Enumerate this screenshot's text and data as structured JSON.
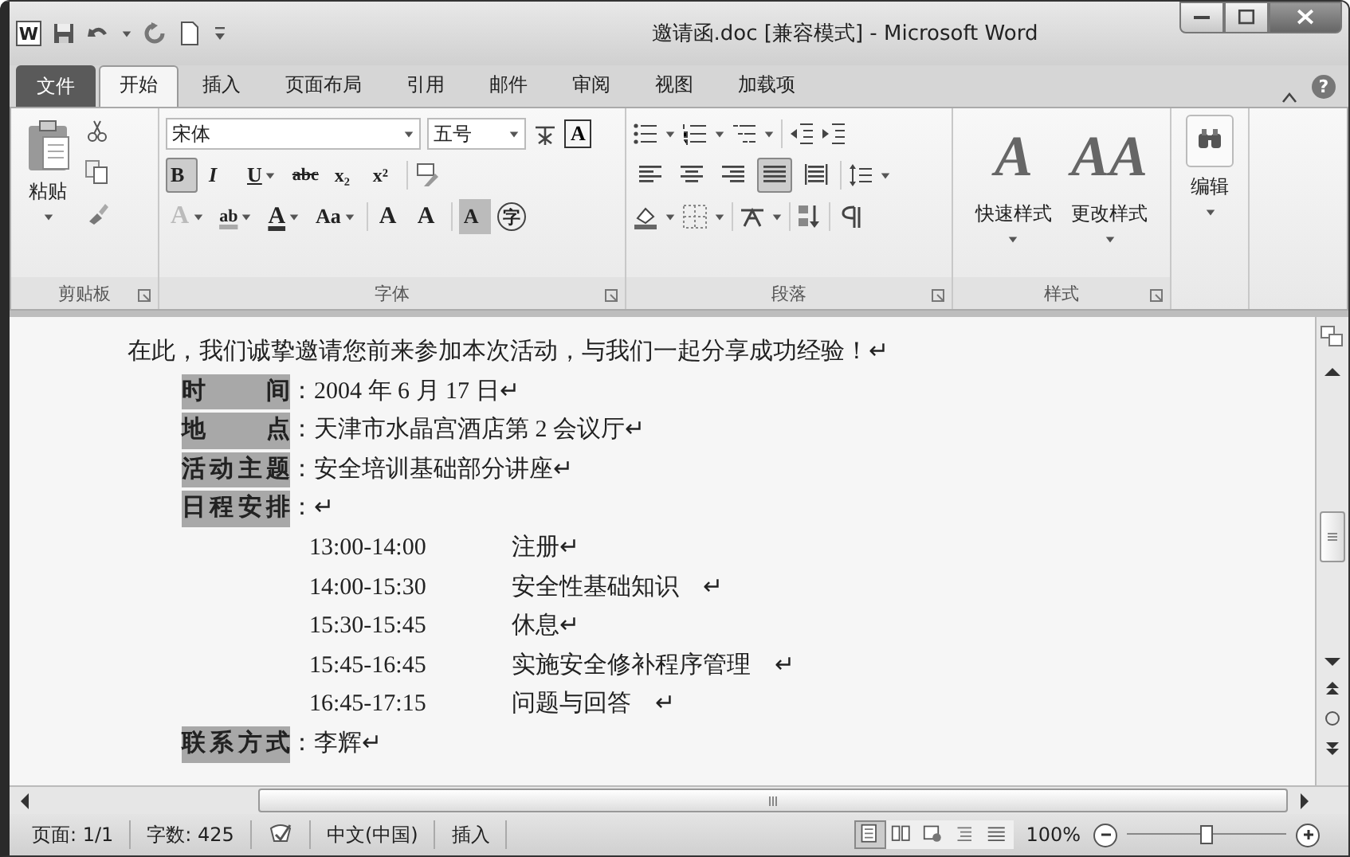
{
  "window": {
    "app_glyph": "W",
    "title": "邀请函.doc [兼容模式] - Microsoft Word",
    "help": "?"
  },
  "tabs": [
    {
      "label": "文件",
      "kind": "file",
      "selected": false
    },
    {
      "label": "开始",
      "kind": "tab",
      "selected": true
    },
    {
      "label": "插入",
      "kind": "tab",
      "selected": false
    },
    {
      "label": "页面布局",
      "kind": "tab",
      "selected": false
    },
    {
      "label": "引用",
      "kind": "tab",
      "selected": false
    },
    {
      "label": "邮件",
      "kind": "tab",
      "selected": false
    },
    {
      "label": "审阅",
      "kind": "tab",
      "selected": false
    },
    {
      "label": "视图",
      "kind": "tab",
      "selected": false
    },
    {
      "label": "加载项",
      "kind": "tab",
      "selected": false
    }
  ],
  "ribbon": {
    "clipboard": {
      "label": "剪贴板",
      "paste": "粘贴"
    },
    "font": {
      "label": "字体",
      "font_name": "宋体",
      "font_size": "五号",
      "box_glyph": "A",
      "format_buttons": [
        {
          "kind": "bold",
          "glyph": "B",
          "selected": true
        },
        {
          "kind": "italic",
          "glyph": "I",
          "selected": false
        },
        {
          "kind": "underline",
          "glyph": "U",
          "selected": false
        },
        {
          "kind": "strike",
          "glyph": "abc",
          "selected": false
        },
        {
          "kind": "subscript",
          "glyph": "x₂",
          "selected": false
        },
        {
          "kind": "superscript",
          "glyph": "x²",
          "selected": false
        }
      ],
      "effect_buttons": [
        {
          "kind": "effect",
          "glyph": "A"
        },
        {
          "kind": "highlight",
          "glyph": "ab"
        },
        {
          "kind": "color",
          "glyph": "A"
        },
        {
          "kind": "case",
          "glyph": "Aa"
        },
        {
          "kind": "grow",
          "glyph": "A"
        },
        {
          "kind": "shrink",
          "glyph": "A"
        },
        {
          "kind": "shade",
          "glyph": "A"
        },
        {
          "kind": "enclose",
          "glyph": "字"
        }
      ]
    },
    "paragraph": {
      "label": "段落",
      "align_buttons": [
        {
          "kind": "align-left",
          "selected": false
        },
        {
          "kind": "align-center",
          "selected": false
        },
        {
          "kind": "align-right",
          "selected": false
        },
        {
          "kind": "justify",
          "selected": true
        },
        {
          "kind": "distribute",
          "selected": false
        }
      ]
    },
    "styles": {
      "label": "样式",
      "buttons": [
        {
          "label": "快速样式",
          "glyph": "A"
        },
        {
          "label": "更改样式",
          "glyph": "AA"
        }
      ]
    },
    "editing": {
      "label": "编辑"
    }
  },
  "document": {
    "intro": "在此，我们诚挚邀请您前来参加本次活动，与我们一起分享成功经验！↵",
    "fields": [
      {
        "label": "时 间",
        "value": "：2004 年 6 月 17 日↵"
      },
      {
        "label": "地 点",
        "value": "：天津市水晶宫酒店第 2 会议厅↵"
      },
      {
        "label": "活动主题",
        "value": "：安全培训基础部分讲座↵"
      },
      {
        "label": "日程安排",
        "value": "：↵"
      }
    ],
    "schedule": [
      {
        "time": "13:00-14:00",
        "item": "注册↵"
      },
      {
        "time": "14:00-15:30",
        "item": "安全性基础知识　↵"
      },
      {
        "time": "15:30-15:45",
        "item": "休息↵"
      },
      {
        "time": "15:45-16:45",
        "item": "实施安全修补程序管理　↵"
      },
      {
        "time": "16:45-17:15",
        "item": "问题与回答　↵"
      }
    ],
    "contact": {
      "label": "联系方式",
      "value": "：李辉↵"
    }
  },
  "status_bar": {
    "page": "页面: 1/1",
    "words": "字数: 425",
    "language": "中文(中国)",
    "mode": "插入",
    "views": [
      {
        "kind": "print",
        "selected": true
      },
      {
        "kind": "reading",
        "selected": false
      },
      {
        "kind": "web",
        "selected": false
      },
      {
        "kind": "outline",
        "selected": false
      },
      {
        "kind": "draft",
        "selected": false
      }
    ],
    "zoom": "100%",
    "zoom_slider": {
      "level": 0.5
    }
  }
}
